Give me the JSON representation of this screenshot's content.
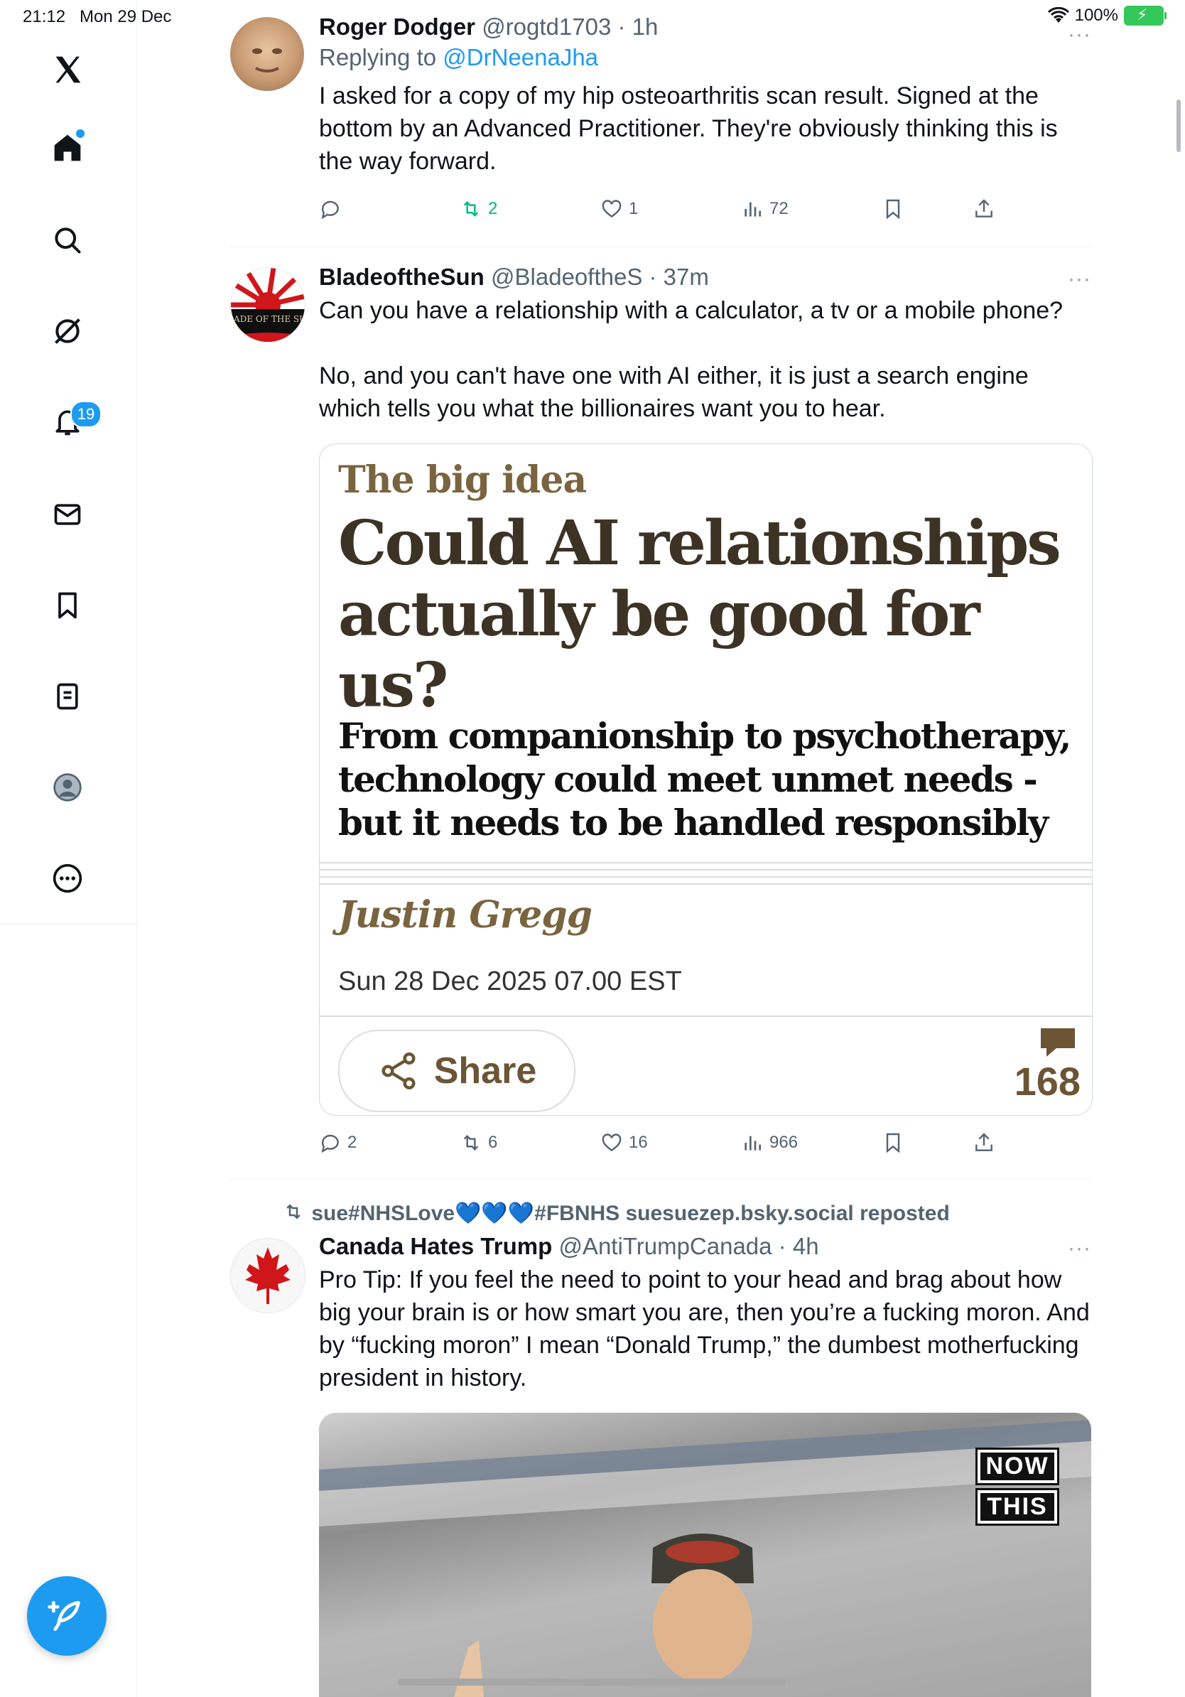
{
  "status_bar": {
    "time": "21:12",
    "date": "Mon 29 Dec",
    "battery": "100%"
  },
  "sidebar": {
    "items": [
      {
        "icon": "x-logo-icon"
      },
      {
        "icon": "home-icon"
      },
      {
        "icon": "search-icon"
      },
      {
        "icon": "grok-icon"
      },
      {
        "icon": "notifications-icon",
        "badge": "19"
      },
      {
        "icon": "messages-icon"
      },
      {
        "icon": "bookmarks-icon"
      },
      {
        "icon": "lists-icon"
      },
      {
        "icon": "profile-icon"
      },
      {
        "icon": "more-icon"
      }
    ]
  },
  "tweets": [
    {
      "name": "Roger Dodger",
      "handle": "@rogtd1703",
      "time": "1h",
      "reply_to_prefix": "Replying to ",
      "reply_to": "@DrNeenaJha",
      "text": "I asked for a copy of my hip osteoarthritis scan result. Signed at the bottom by an Advanced Practitioner. They're obviously thinking this is the way forward.",
      "replies": "",
      "reposts": "2",
      "likes": "1",
      "views": "72"
    },
    {
      "name": "BladeoftheSun",
      "handle": "@BladeoftheS",
      "time": "37m",
      "avatar_text": "BLADE OF THE SUN",
      "text": "Can you have a relationship with a calculator, a tv or a mobile phone?\n\nNo, and you can't have one with AI either, it is just a search engine which tells you what the billionaires want you to hear.",
      "card": {
        "kicker": "The big idea",
        "headline": "Could AI relationships actually be good for us?",
        "standfirst": "From companionship to psychotherapy, technology could meet unmet needs - but it needs to be handled responsibly",
        "byline": "Justin Gregg",
        "dateline": "Sun 28 Dec 2025 07.00 EST",
        "share_label": "Share",
        "comment_count": "168"
      },
      "replies": "2",
      "reposts": "6",
      "likes": "16",
      "views": "966"
    },
    {
      "reposted_by": "sue#NHSLove💙💙💙#FBNHS suesuezep.bsky.social reposted",
      "name": "Canada Hates Trump",
      "handle": "@AntiTrumpCanada",
      "time": "4h",
      "text": "Pro Tip: If you feel the need to point to your head and brag about how big your brain is or how smart you are, then you’re a fucking moron. And by “fucking moron” I mean “Donald Trump,” the dumbest motherfucking president in history.",
      "video": {
        "logo_top": "NOW",
        "logo_bottom": "THIS"
      }
    }
  ],
  "colors": {
    "accent": "#1d9bf0",
    "repost_green": "#00ba7c",
    "secondary": "#536471"
  }
}
